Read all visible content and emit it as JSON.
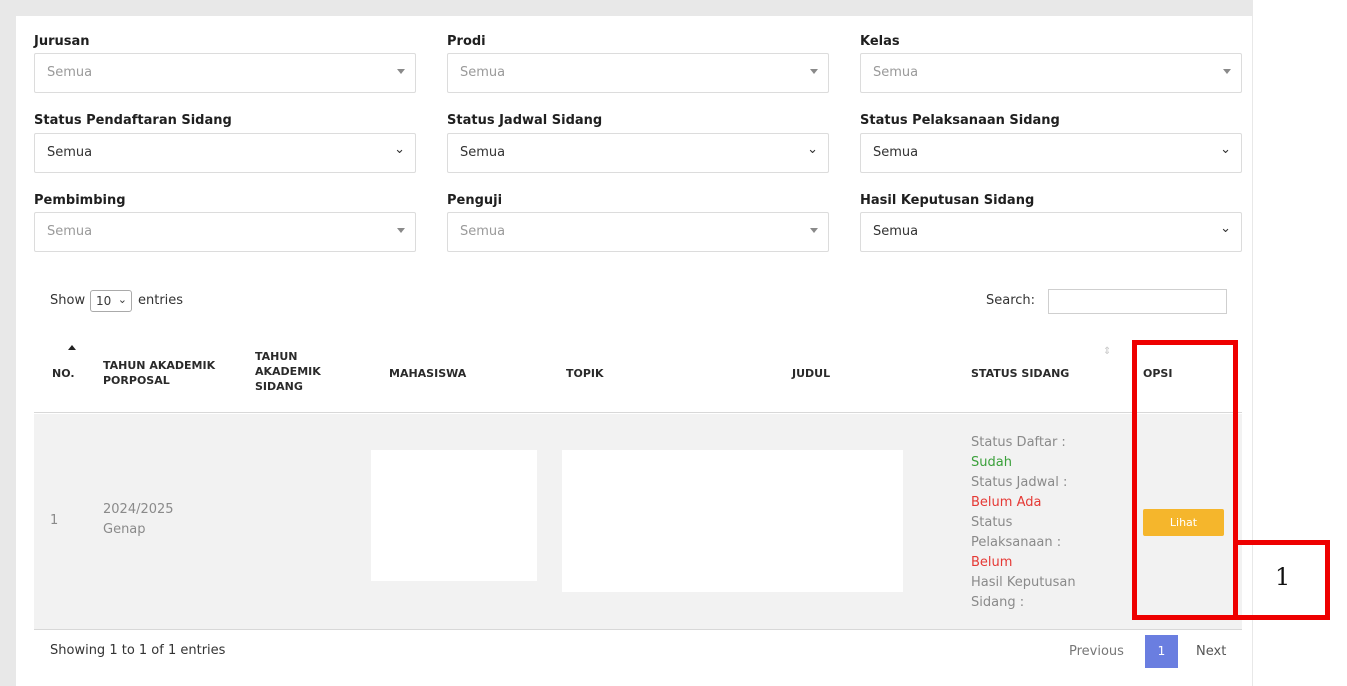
{
  "filters": [
    {
      "label": "Jurusan",
      "value": "Semua"
    },
    {
      "label": "Prodi",
      "value": "Semua"
    },
    {
      "label": "Kelas",
      "value": "Semua"
    },
    {
      "label": "Status Pendaftaran Sidang",
      "value": "Semua"
    },
    {
      "label": "Status Jadwal Sidang",
      "value": "Semua"
    },
    {
      "label": "Status Pelaksanaan Sidang",
      "value": "Semua"
    },
    {
      "label": "Pembimbing",
      "value": "Semua"
    },
    {
      "label": "Penguji",
      "value": "Semua"
    },
    {
      "label": "Hasil Keputusan Sidang",
      "value": "Semua"
    }
  ],
  "table_controls": {
    "show_label": "Show",
    "page_length": "10",
    "entries_label": "entries",
    "search_label": "Search:"
  },
  "columns": [
    "NO.",
    [
      "TAHUN AKADEMIK",
      "PORPOSAL"
    ],
    [
      "TAHUN",
      "AKADEMIK",
      "SIDANG"
    ],
    "MAHASISWA",
    "TOPIK",
    "JUDUL",
    "STATUS SIDANG",
    "OPSI"
  ],
  "rows": [
    {
      "no": "1",
      "tahun_akademik": [
        "2024/2025",
        "Genap"
      ],
      "status": [
        {
          "text": "Status Daftar :",
          "color": "grey"
        },
        {
          "text": "Sudah",
          "color": "green"
        },
        {
          "text": "Status Jadwal :",
          "color": "grey"
        },
        {
          "text": "Belum Ada",
          "color": "red"
        },
        {
          "text": "Status",
          "color": "grey"
        },
        {
          "text": "Pelaksanaan :",
          "color": "grey"
        },
        {
          "text": "Belum",
          "color": "red"
        },
        {
          "text": "Hasil Keputusan",
          "color": "grey"
        },
        {
          "text": "Sidang :",
          "color": "grey"
        }
      ],
      "action_label": "Lihat"
    }
  ],
  "footer": {
    "info": "Showing 1 to 1 of 1 entries",
    "previous": "Previous",
    "current_page": "1",
    "next": "Next"
  },
  "annotation": {
    "label": "1"
  },
  "colors": {
    "status_green": "#3aa03a",
    "status_red": "#e53935",
    "button": "#f5b62c",
    "page_active": "#6a7ee0",
    "highlight": "#ee0000"
  }
}
